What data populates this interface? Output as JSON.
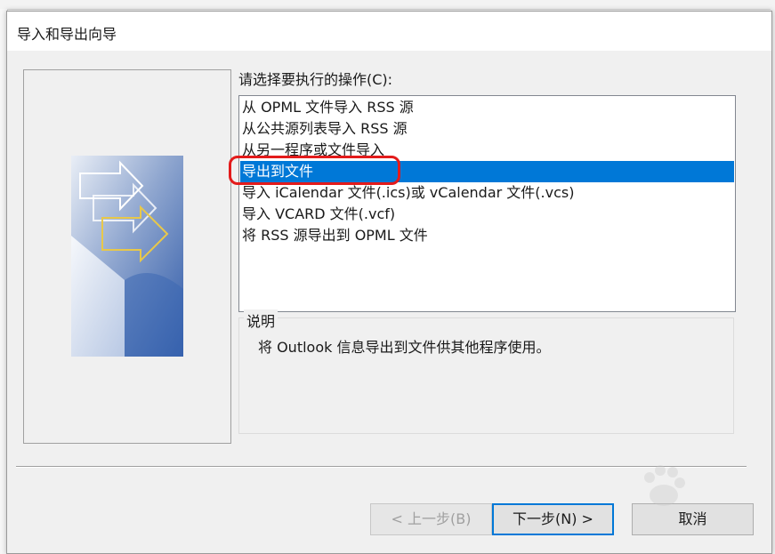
{
  "window": {
    "title": "导入和导出向导"
  },
  "prompt": {
    "label": "请选择要执行的操作(C):"
  },
  "options": [
    {
      "label": "从 OPML 文件导入 RSS 源",
      "selected": false
    },
    {
      "label": "从公共源列表导入 RSS 源",
      "selected": false
    },
    {
      "label": "从另一程序或文件导入",
      "selected": false
    },
    {
      "label": "导出到文件",
      "selected": true
    },
    {
      "label": "导入 iCalendar 文件(.ics)或 vCalendar 文件(.vcs)",
      "selected": false
    },
    {
      "label": "导入 VCARD 文件(.vcf)",
      "selected": false
    },
    {
      "label": "将 RSS 源导出到 OPML 文件",
      "selected": false
    }
  ],
  "description": {
    "legend": "说明",
    "text": "将 Outlook 信息导出到文件供其他程序使用。"
  },
  "buttons": {
    "back": "< 上一步(B)",
    "next": "下一步(N) >",
    "cancel": "取消"
  },
  "colors": {
    "selection": "#0078d7",
    "highlight_ring": "#e31b1b",
    "dialog_bg": "#f0f0f0"
  },
  "icons": {
    "wizard_graphic": "wizard-arrows-illustration"
  }
}
